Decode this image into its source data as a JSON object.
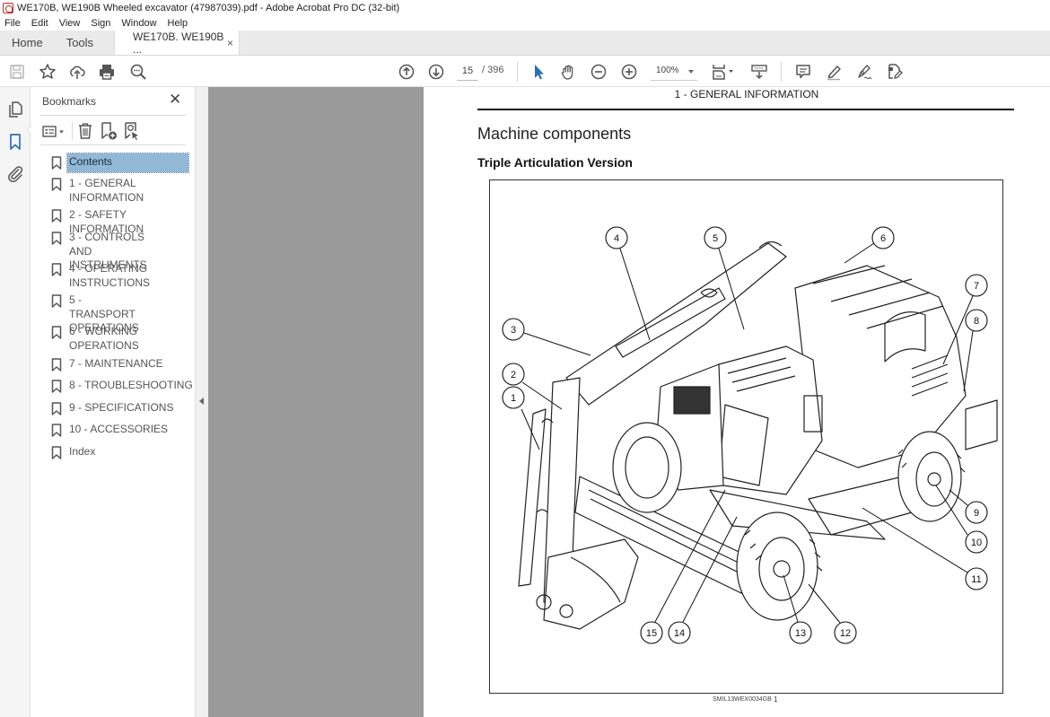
{
  "window": {
    "title": "WE170B, WE190B Wheeled excavator (47987039).pdf - Adobe Acrobat Pro DC (32-bit)"
  },
  "menu": [
    "File",
    "Edit",
    "View",
    "Sign",
    "Window",
    "Help"
  ],
  "tabs": {
    "home": "Home",
    "tools": "Tools",
    "document": "WE170B. WE190B ...",
    "close": "×"
  },
  "toolbar": {
    "left_icons": [
      "save-icon",
      "bookmark-star-icon",
      "upload-cloud-icon",
      "print-icon",
      "find-zoom-icon"
    ],
    "page_current": "15",
    "page_total": "/ 396",
    "zoom_level": "100%",
    "accent_color": "#2d6fb7"
  },
  "bookmarks_panel": {
    "title": "Bookmarks",
    "close": "✕",
    "items": [
      {
        "label": "Contents",
        "selected": true
      },
      {
        "label": "1 - GENERAL INFORMATION"
      },
      {
        "label": "2 - SAFETY INFORMATION"
      },
      {
        "label": "3 - CONTROLS AND INSTRUMENTS"
      },
      {
        "label": "4 - OPERATING INSTRUCTIONS"
      },
      {
        "label": "5 - TRANSPORT OPERATIONS"
      },
      {
        "label": "6 - WORKING OPERATIONS"
      },
      {
        "label": "7 - MAINTENANCE"
      },
      {
        "label": "8 - TROUBLESHOOTING"
      },
      {
        "label": "9 - SPECIFICATIONS"
      },
      {
        "label": "10 - ACCESSORIES"
      },
      {
        "label": "Index"
      }
    ]
  },
  "page": {
    "header": "1 - GENERAL INFORMATION",
    "heading": "Machine components",
    "subheading": "Triple Articulation Version",
    "figure_caption": "SMIL13WEX0034GB",
    "figure_number": "1",
    "callouts": [
      "1",
      "2",
      "3",
      "4",
      "5",
      "6",
      "7",
      "8",
      "9",
      "10",
      "11",
      "12",
      "13",
      "14",
      "15"
    ]
  }
}
